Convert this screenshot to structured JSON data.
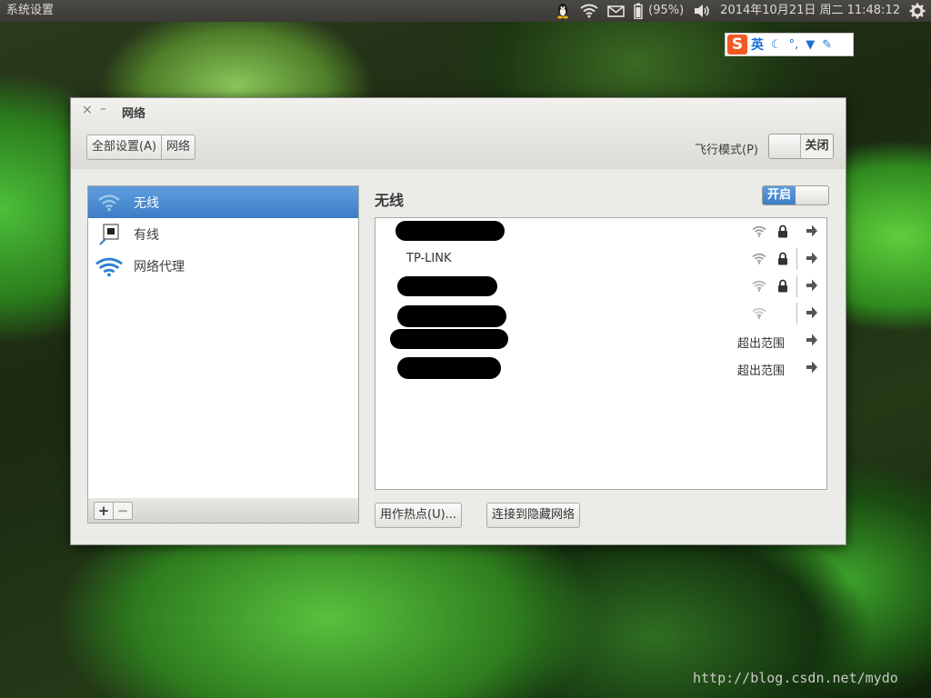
{
  "top_panel": {
    "app_title": "系统设置",
    "battery_text": "(95%)",
    "datetime": "2014年10月21日 周二 11:48:12",
    "icons": [
      "tux-icon",
      "wifi-icon",
      "mail-icon",
      "battery-icon",
      "volume-icon",
      "gear-icon"
    ]
  },
  "ime": {
    "lang": "英",
    "icons": [
      "moon-icon",
      "punctuation-icon",
      "shirt-icon",
      "wrench-icon"
    ]
  },
  "window": {
    "title": "网络",
    "close_glyph": "×",
    "min_glyph": "–",
    "breadcrumb": {
      "all_settings": "全部设置(A)",
      "current": "网络"
    },
    "airplane_label": "飞行模式(P)",
    "airplane_state": "关闭"
  },
  "sidebar": {
    "items": [
      {
        "label": "无线",
        "icon": "wifi-icon",
        "selected": true
      },
      {
        "label": "有线",
        "icon": "wired-icon",
        "selected": false
      },
      {
        "label": "网络代理",
        "icon": "proxy-icon",
        "selected": false
      }
    ],
    "add": "+",
    "remove": "−"
  },
  "panel": {
    "title": "无线",
    "switch_label": "开启",
    "networks": [
      {
        "ssid": "",
        "redacted": true,
        "secured": true,
        "in_range": true
      },
      {
        "ssid": "TP-LINK",
        "redacted": false,
        "secured": true,
        "in_range": true
      },
      {
        "ssid": "",
        "redacted": true,
        "secured": true,
        "in_range": true
      },
      {
        "ssid": "",
        "redacted": true,
        "secured": false,
        "in_range": true
      },
      {
        "ssid": "",
        "redacted": true,
        "secured": false,
        "in_range": false,
        "status": "超出范围"
      },
      {
        "ssid": "",
        "redacted": true,
        "secured": false,
        "in_range": false,
        "status": "超出范围"
      }
    ],
    "hotspot_button": "用作热点(U)...",
    "hidden_network_button": "连接到隐藏网络"
  },
  "watermark": "http://blog.csdn.net/mydo",
  "colors": {
    "accent": "#4a8ad4",
    "panel_bg": "#3c3b37",
    "window_bg": "#ebebe8"
  }
}
